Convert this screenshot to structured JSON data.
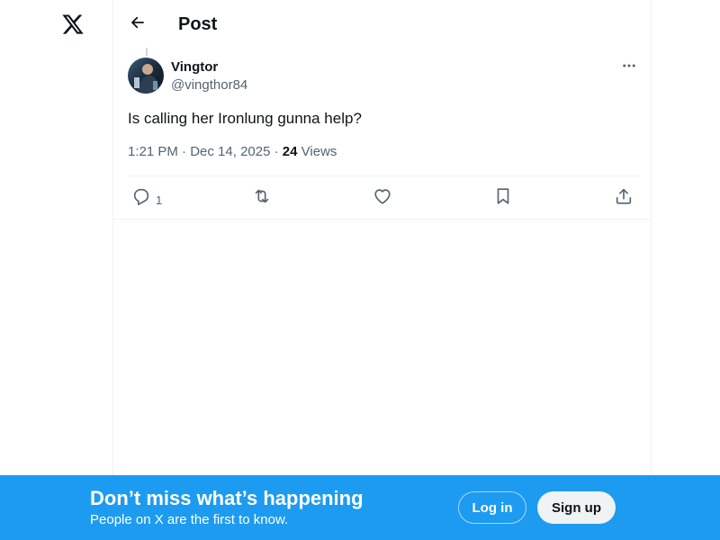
{
  "colors": {
    "text_primary": "#0f1419",
    "text_secondary": "#536471",
    "divider": "#eff3f4",
    "banner_bg": "#1d9bf0",
    "signup_bg": "#eff3f4"
  },
  "icons": {
    "logo": "x-logo-icon",
    "back": "arrow-left-icon",
    "more": "more-dots-icon",
    "reply": "reply-icon",
    "repost": "repost-icon",
    "like": "heart-icon",
    "bookmark": "bookmark-icon",
    "share": "share-icon"
  },
  "header": {
    "title": "Post"
  },
  "post": {
    "author": {
      "display_name": "Vingtor",
      "handle": "@vingthor84"
    },
    "text": "Is calling her Ironlung gunna help?",
    "meta": {
      "time": "1:21 PM",
      "separator": " · ",
      "date": "Dec 14, 2025",
      "views_count": "24",
      "views_label": "Views"
    },
    "actions": {
      "reply_count": "1"
    }
  },
  "banner": {
    "heading": "Don’t miss what’s happening",
    "subheading": "People on X are the first to know.",
    "login_label": "Log in",
    "signup_label": "Sign up"
  }
}
